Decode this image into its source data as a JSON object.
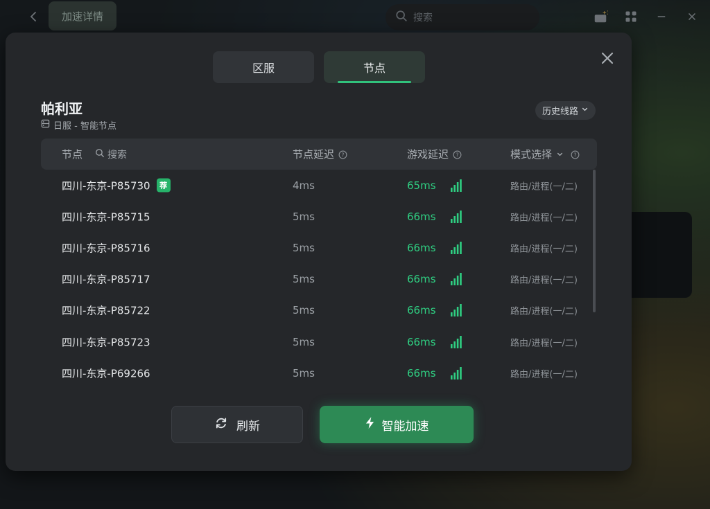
{
  "app": {
    "page_title": "加速详情",
    "search_placeholder": "搜索"
  },
  "modal": {
    "tabs": [
      {
        "label": "区服",
        "active": false
      },
      {
        "label": "节点",
        "active": true
      }
    ],
    "server_name": "帕利亚",
    "server_sub": "日服 - 智能节点",
    "history_label": "历史线路",
    "header": {
      "node": "节点",
      "search": "搜索",
      "node_delay": "节点延迟",
      "game_delay": "游戏延迟",
      "mode": "模式选择"
    },
    "rows": [
      {
        "name": "四川-东京-P85730",
        "badge": "荐",
        "node_delay": "4ms",
        "game_delay": "65ms",
        "mode": "路由/进程(一/二)"
      },
      {
        "name": "四川-东京-P85715",
        "badge": "",
        "node_delay": "5ms",
        "game_delay": "66ms",
        "mode": "路由/进程(一/二)"
      },
      {
        "name": "四川-东京-P85716",
        "badge": "",
        "node_delay": "5ms",
        "game_delay": "66ms",
        "mode": "路由/进程(一/二)"
      },
      {
        "name": "四川-东京-P85717",
        "badge": "",
        "node_delay": "5ms",
        "game_delay": "66ms",
        "mode": "路由/进程(一/二)"
      },
      {
        "name": "四川-东京-P85722",
        "badge": "",
        "node_delay": "5ms",
        "game_delay": "66ms",
        "mode": "路由/进程(一/二)"
      },
      {
        "name": "四川-东京-P85723",
        "badge": "",
        "node_delay": "5ms",
        "game_delay": "66ms",
        "mode": "路由/进程(一/二)"
      },
      {
        "name": "四川-东京-P69266",
        "badge": "",
        "node_delay": "5ms",
        "game_delay": "66ms",
        "mode": "路由/进程(一/二)"
      }
    ],
    "refresh_label": "刷新",
    "boost_label": "智能加速"
  },
  "colors": {
    "accent": "#31c27c",
    "good_latency": "#2fcf82",
    "boost_button": "#2d8a55",
    "modal_bg": "#25272a"
  },
  "icons": {
    "back": "chevron-left-icon",
    "search": "search-icon",
    "gift": "gift-icon",
    "apps": "grid-icon",
    "minimize": "minimize-icon",
    "window_close": "close-icon",
    "modal_close": "close-icon",
    "server": "server-icon",
    "history_dropdown": "chevron-down-icon",
    "help": "help-circle-icon",
    "signal": "signal-bars-icon",
    "refresh": "refresh-icon",
    "boost": "lightning-icon"
  }
}
